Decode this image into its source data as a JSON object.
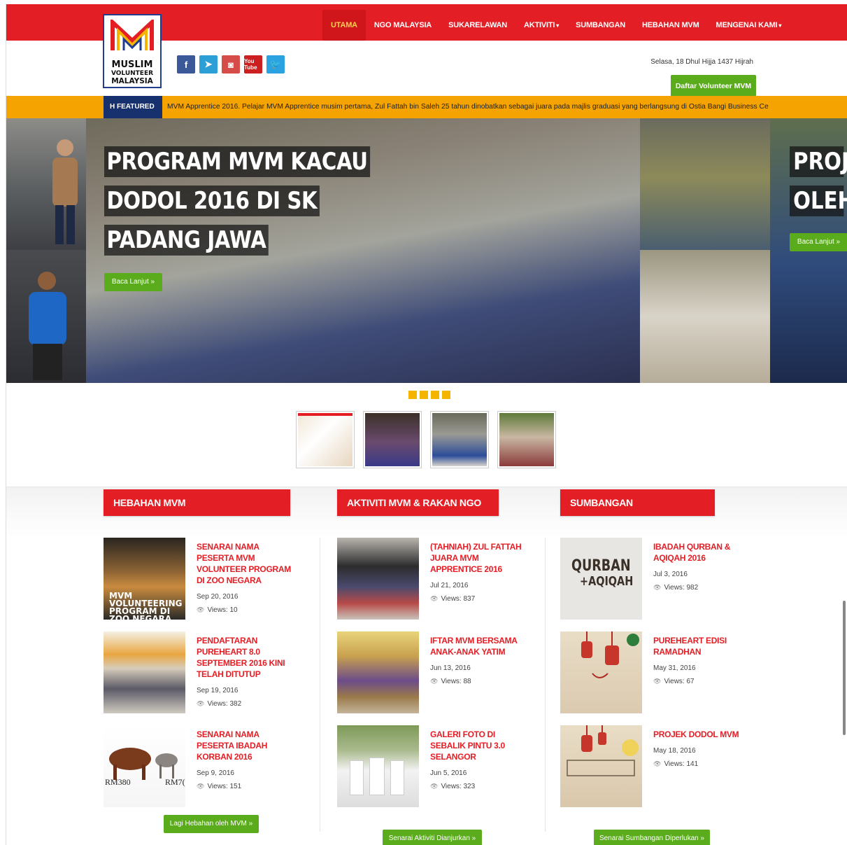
{
  "nav": {
    "items": [
      {
        "label": "UTAMA",
        "active": true,
        "dropdown": false
      },
      {
        "label": "NGO MALAYSIA",
        "active": false,
        "dropdown": false
      },
      {
        "label": "SUKARELAWAN",
        "active": false,
        "dropdown": false
      },
      {
        "label": "AKTIVITI",
        "active": false,
        "dropdown": true
      },
      {
        "label": "SUMBANGAN",
        "active": false,
        "dropdown": false
      },
      {
        "label": "HEBAHAN MVM",
        "active": false,
        "dropdown": false
      },
      {
        "label": "MENGENAI KAMI",
        "active": false,
        "dropdown": true
      }
    ],
    "caret": "▾"
  },
  "logo": {
    "line1": "MUSLIM",
    "line2": "VOLUNTEER",
    "line3": "MALAYSIA"
  },
  "social": {
    "facebook": "f",
    "telegram": "➤",
    "instagram": "◙",
    "youtube": "You Tube",
    "twitter": "🐦"
  },
  "header": {
    "date": "Selasa, 18 Dhul Hijja 1437 Hijrah",
    "daftar_button": "Daftar Volunteer MVM"
  },
  "featured": {
    "label": "FEATURED",
    "text": "MVM Apprentice 2016. Pelajar MVM Apprentice musim pertama, Zul Fattah bin Saleh 25 tahun dinobatkan sebagai juara pada majlis graduasi yang berlangsung di Ostia Bangi Business Ce"
  },
  "hero": {
    "title_lines": [
      "PROGRAM MVM KACAU",
      "DODOL 2016 DI SK",
      "PADANG JAWA"
    ],
    "button": "Baca Lanjut »",
    "next_title_lines": [
      "PROJ",
      "OLEH"
    ],
    "next_button": "Baca Lanjut »"
  },
  "columns": {
    "hebahan": {
      "title": "HEBAHAN MVM",
      "posts": [
        {
          "title": "SENARAI NAMA PESERTA MVM VOLUNTEER PROGRAM DI ZOO NEGARA",
          "date": "Sep 20, 2016",
          "views": "Views: 10",
          "img_caption": "MVM VOLUNTEERING PROGRAM DI ZOO NEGARA"
        },
        {
          "title": "PENDAFTARAN PUREHEART 8.0 SEPTEMBER 2016 KINI TELAH DITUTUP",
          "date": "Sep 19, 2016",
          "views": "Views: 382"
        },
        {
          "title": "SENARAI NAMA PESERTA IBADAH KORBAN 2016",
          "date": "Sep 9, 2016",
          "views": "Views: 151",
          "img_caption_left": "RM380",
          "img_caption_right": "RM7("
        }
      ],
      "more": "Lagi Hebahan oleh MVM »"
    },
    "aktiviti": {
      "title": "AKTIVITI MVM & RAKAN NGO",
      "posts": [
        {
          "title": "(TAHNIAH) ZUL FATTAH JUARA MVM APPRENTICE 2016",
          "date": "Jul 21, 2016",
          "views": "Views: 837"
        },
        {
          "title": "IFTAR MVM BERSAMA ANAK-ANAK YATIM",
          "date": "Jun 13, 2016",
          "views": "Views: 88"
        },
        {
          "title": "GALERI FOTO DI SEBALIK PINTU 3.0 SELANGOR",
          "date": "Jun 5, 2016",
          "views": "Views: 323"
        }
      ],
      "more": "Senarai Aktiviti Dianjurkan »"
    },
    "sumbangan": {
      "title": "SUMBANGAN",
      "posts": [
        {
          "title": "IBADAH QURBAN & AQIQAH 2016",
          "date": "Jul 3, 2016",
          "views": "Views: 982",
          "img_text1": "QURBAN",
          "img_text2": "+AQIQAH"
        },
        {
          "title": "PUREHEART EDISI RAMADHAN",
          "date": "May 31, 2016",
          "views": "Views: 67"
        },
        {
          "title": "PROJEK DODOL MVM",
          "date": "May 18, 2016",
          "views": "Views: 141"
        }
      ],
      "more": "Senarai Sumbangan Diperlukan »"
    }
  },
  "colors": {
    "brand_red": "#e31e25",
    "accent_green": "#5aac1d",
    "featured_orange": "#f5a300",
    "navy": "#16316e"
  }
}
